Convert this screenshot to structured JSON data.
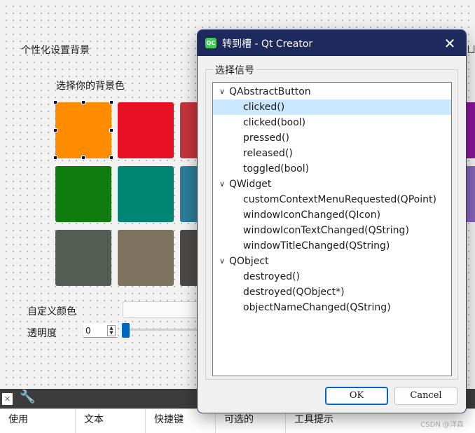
{
  "form": {
    "group_title": "个性化设置背景",
    "pick_label": "选择你的背景色",
    "custom_color_label": "自定义颜色",
    "opacity_label": "透明度",
    "opacity_value": "0",
    "spin_up": "▲",
    "spin_down": "▼",
    "right_edge_fragment": "ㄩ",
    "swatches": [
      {
        "color": "#ff8c00"
      },
      {
        "color": "#e81123"
      },
      {
        "color": "#c5343b"
      },
      {
        "color": "#107c10"
      },
      {
        "color": "#008575"
      },
      {
        "color": "#2d7d9a"
      },
      {
        "color": "#525e54"
      },
      {
        "color": "#7e735f"
      },
      {
        "color": "#4c4a48"
      }
    ],
    "right_swatches": [
      {
        "color": "#881798"
      },
      {
        "color": "#8764b8"
      }
    ]
  },
  "bottom": {
    "headers": [
      "使用",
      "文本",
      "快捷键",
      "可选的",
      "工具提示"
    ],
    "watermark": "CSDN @洋森"
  },
  "dialog": {
    "title": "转到槽 - Qt Creator",
    "logo": "QC",
    "close": "✕",
    "group_label": "选择信号",
    "tree": [
      {
        "label": "QAbstractButton",
        "type": "group",
        "chevron": "∨"
      },
      {
        "label": "clicked()",
        "type": "child",
        "selected": true
      },
      {
        "label": "clicked(bool)",
        "type": "child"
      },
      {
        "label": "pressed()",
        "type": "child"
      },
      {
        "label": "released()",
        "type": "child"
      },
      {
        "label": "toggled(bool)",
        "type": "child"
      },
      {
        "label": "QWidget",
        "type": "group",
        "chevron": "∨"
      },
      {
        "label": "customContextMenuRequested(QPoint)",
        "type": "child"
      },
      {
        "label": "windowIconChanged(QIcon)",
        "type": "child"
      },
      {
        "label": "windowIconTextChanged(QString)",
        "type": "child"
      },
      {
        "label": "windowTitleChanged(QString)",
        "type": "child"
      },
      {
        "label": "QObject",
        "type": "group",
        "chevron": "∨"
      },
      {
        "label": "destroyed()",
        "type": "child"
      },
      {
        "label": "destroyed(QObject*)",
        "type": "child"
      },
      {
        "label": "objectNameChanged(QString)",
        "type": "child"
      }
    ],
    "ok_label": "OK",
    "cancel_label": "Cancel"
  }
}
